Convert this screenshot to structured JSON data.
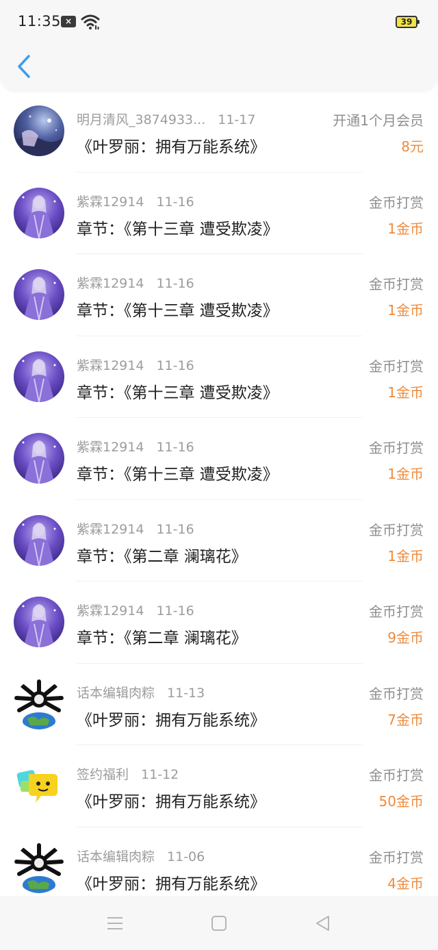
{
  "status_bar": {
    "time": "11:35",
    "battery": "39"
  },
  "colors": {
    "accent": "#3d9df0",
    "amount": "#f08a3a"
  },
  "records": [
    {
      "user": "明月清风_3874933...",
      "date": "11-17",
      "title": "《叶罗丽：拥有万能系统》",
      "kind": "开通1个月会员",
      "amount": "8元",
      "avatar": "night-sky"
    },
    {
      "user": "紫霖12914",
      "date": "11-16",
      "title": "章节：《第十三章 遭受欺凌》",
      "kind": "金币打赏",
      "amount": "1金币",
      "avatar": "purple-girl"
    },
    {
      "user": "紫霖12914",
      "date": "11-16",
      "title": "章节：《第十三章 遭受欺凌》",
      "kind": "金币打赏",
      "amount": "1金币",
      "avatar": "purple-girl"
    },
    {
      "user": "紫霖12914",
      "date": "11-16",
      "title": "章节：《第十三章 遭受欺凌》",
      "kind": "金币打赏",
      "amount": "1金币",
      "avatar": "purple-girl"
    },
    {
      "user": "紫霖12914",
      "date": "11-16",
      "title": "章节：《第十三章 遭受欺凌》",
      "kind": "金币打赏",
      "amount": "1金币",
      "avatar": "purple-girl"
    },
    {
      "user": "紫霖12914",
      "date": "11-16",
      "title": "章节：《第二章 澜璃花》",
      "kind": "金币打赏",
      "amount": "1金币",
      "avatar": "purple-girl"
    },
    {
      "user": "紫霖12914",
      "date": "11-16",
      "title": "章节：《第二章 澜璃花》",
      "kind": "金币打赏",
      "amount": "9金币",
      "avatar": "purple-girl"
    },
    {
      "user": "话本编辑肉粽",
      "date": "11-13",
      "title": "《叶罗丽：拥有万能系统》",
      "kind": "金币打赏",
      "amount": "7金币",
      "avatar": "spider-globe"
    },
    {
      "user": "签约福利",
      "date": "11-12",
      "title": "《叶罗丽：拥有万能系统》",
      "kind": "金币打赏",
      "amount": "50金币",
      "avatar": "chat-bubble"
    },
    {
      "user": "话本编辑肉粽",
      "date": "11-06",
      "title": "《叶罗丽：拥有万能系统》",
      "kind": "金币打赏",
      "amount": "4金币",
      "avatar": "spider-globe"
    }
  ]
}
